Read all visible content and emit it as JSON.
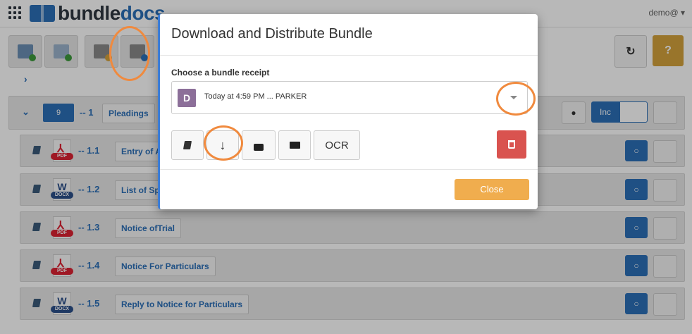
{
  "app": {
    "logo_part1": "bundle",
    "logo_part2": "docs",
    "user_menu": "demo@ ▾"
  },
  "colors": {
    "primary": "#2c6fb7",
    "danger": "#d9534f",
    "warning": "#f0ad4e",
    "highlight": "#f08a3e",
    "avatar": "#8c6f99"
  },
  "section": {
    "folder_number": "9",
    "index": "1",
    "name": "Pleadings",
    "inc_label": "Inc"
  },
  "documents": [
    {
      "index": "1.1",
      "name": "Entry of Appearance",
      "type": "pdf",
      "type_label": "PDF"
    },
    {
      "index": "1.2",
      "name": "List of Special Damages",
      "type": "docx",
      "type_label": "DOCX"
    },
    {
      "index": "1.3",
      "name": "Notice ofTrial",
      "type": "pdf",
      "type_label": "PDF"
    },
    {
      "index": "1.4",
      "name": "Notice For Particulars",
      "type": "pdf",
      "type_label": "PDF"
    },
    {
      "index": "1.5",
      "name": "Reply to Notice for Particulars",
      "type": "docx",
      "type_label": "DOCX"
    }
  ],
  "modal": {
    "title": "Download and Distribute Bundle",
    "receipt_label": "Choose a bundle receipt",
    "receipt": {
      "avatar_letter": "D",
      "text": "Today at 4:59 PM ... PARKER"
    },
    "actions": {
      "ocr_label": "OCR"
    },
    "close_label": "Close"
  }
}
